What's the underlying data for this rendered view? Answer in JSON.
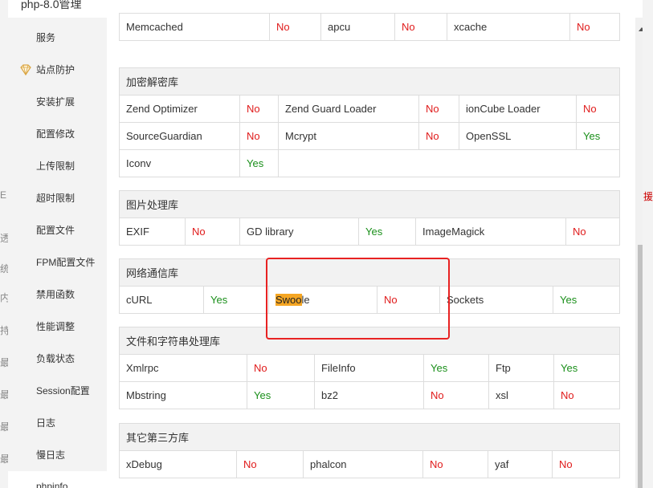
{
  "background": {
    "left_chars": [
      "E",
      "透",
      "统",
      "内",
      "持",
      "最",
      "最",
      "最",
      "最"
    ],
    "right_char": "援"
  },
  "window": {
    "title": "php-8.0管理"
  },
  "sidebar": {
    "items": [
      {
        "label": "服务"
      },
      {
        "label": "站点防护",
        "icon": "diamond-icon"
      },
      {
        "label": "安装扩展"
      },
      {
        "label": "配置修改"
      },
      {
        "label": "上传限制"
      },
      {
        "label": "超时限制"
      },
      {
        "label": "配置文件"
      },
      {
        "label": "FPM配置文件"
      },
      {
        "label": "禁用函数"
      },
      {
        "label": "性能调整"
      },
      {
        "label": "负载状态"
      },
      {
        "label": "Session配置"
      },
      {
        "label": "日志"
      },
      {
        "label": "慢日志"
      },
      {
        "label": "phpinfo"
      }
    ]
  },
  "cache_row": [
    {
      "name": "Memcached",
      "status": "No"
    },
    {
      "name": "apcu",
      "status": "No"
    },
    {
      "name": "xcache",
      "status": "No"
    }
  ],
  "groups": {
    "crypto": {
      "title": "加密解密库",
      "rows": [
        [
          {
            "name": "Zend Optimizer",
            "status": "No"
          },
          {
            "name": "Zend Guard Loader",
            "status": "No"
          },
          {
            "name": "ionCube Loader",
            "status": "No"
          }
        ],
        [
          {
            "name": "SourceGuardian",
            "status": "No"
          },
          {
            "name": "Mcrypt",
            "status": "No"
          },
          {
            "name": "OpenSSL",
            "status": "Yes"
          }
        ],
        [
          {
            "name": "Iconv",
            "status": "Yes"
          }
        ]
      ]
    },
    "image": {
      "title": "图片处理库",
      "rows": [
        [
          {
            "name": "EXIF",
            "status": "No"
          },
          {
            "name": "GD library",
            "status": "Yes"
          },
          {
            "name": "ImageMagick",
            "status": "No"
          }
        ]
      ]
    },
    "network": {
      "title": "网络通信库",
      "rows": [
        [
          {
            "name": "cURL",
            "status": "Yes"
          },
          {
            "name": "Swoole",
            "highlight": "Swoo",
            "rest": "le",
            "status": "No"
          },
          {
            "name": "Sockets",
            "status": "Yes"
          }
        ]
      ]
    },
    "string": {
      "title": "文件和字符串处理库",
      "rows": [
        [
          {
            "name": "Xmlrpc",
            "status": "No"
          },
          {
            "name": "FileInfo",
            "status": "Yes"
          },
          {
            "name": "Ftp",
            "status": "Yes"
          }
        ],
        [
          {
            "name": "Mbstring",
            "status": "Yes"
          },
          {
            "name": "bz2",
            "status": "No"
          },
          {
            "name": "xsl",
            "status": "No"
          }
        ]
      ]
    },
    "other": {
      "title": "其它第三方库",
      "rows": [
        [
          {
            "name": "xDebug",
            "status": "No"
          },
          {
            "name": "phalcon",
            "status": "No"
          },
          {
            "name": "yaf",
            "status": "No"
          }
        ]
      ]
    }
  },
  "colors": {
    "yes": "#1a8f1a",
    "no": "#e01b1b",
    "highlight": "#f5a623",
    "annotation_box": "#e82222"
  }
}
